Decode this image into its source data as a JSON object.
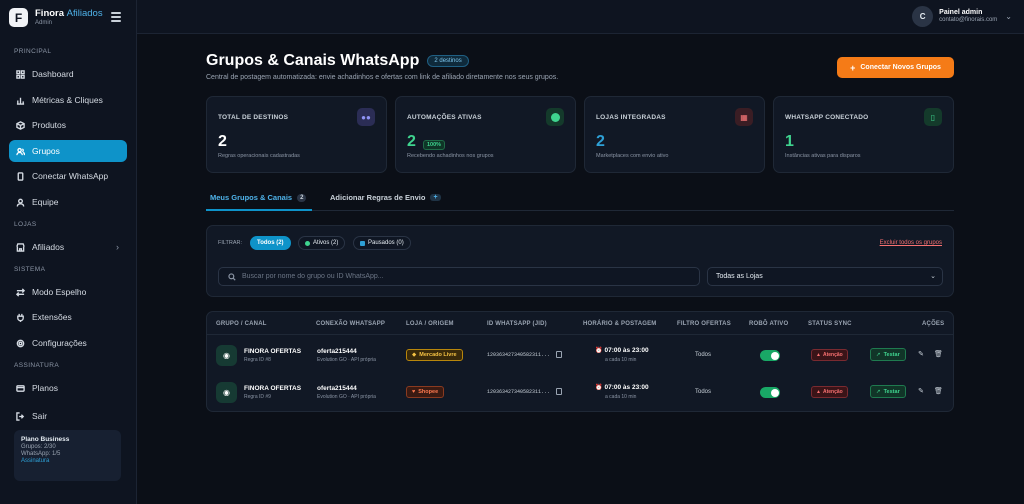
{
  "brand": {
    "logo_letter": "F",
    "name": "Finora",
    "name_accent": "Afiliados",
    "role": "Admin"
  },
  "sidebar": {
    "sections": {
      "principal": "PRINCIPAL",
      "lojas": "LOJAS",
      "sistema": "SISTEMA",
      "assinatura": "ASSINATURA"
    },
    "items": [
      {
        "label": "Dashboard",
        "icon": "grid-icon"
      },
      {
        "label": "Métricas & Cliques",
        "icon": "bar-chart-icon"
      },
      {
        "label": "Produtos",
        "icon": "box-icon"
      },
      {
        "label": "Grupos",
        "icon": "users-icon",
        "active": true
      },
      {
        "label": "Conectar WhatsApp",
        "icon": "phone-icon"
      },
      {
        "label": "Equipe",
        "icon": "user-icon"
      },
      {
        "label": "Afiliados",
        "icon": "store-icon"
      },
      {
        "label": "Modo Espelho",
        "icon": "swap-icon"
      },
      {
        "label": "Extensões",
        "icon": "plug-icon"
      },
      {
        "label": "Configurações",
        "icon": "gear-icon"
      },
      {
        "label": "Planos",
        "icon": "card-icon"
      },
      {
        "label": "Sair",
        "icon": "logout-icon"
      }
    ],
    "plan": {
      "title": "Plano Business",
      "groups": "Grupos: 2/30",
      "whatsapp": "WhatsApp: 1/5",
      "link": "Assinatura"
    }
  },
  "user": {
    "initial": "C",
    "name": "Painel admin",
    "email": "contato@finorais.com"
  },
  "header": {
    "title": "Grupos & Canais WhatsApp",
    "badge": "2 destinos",
    "subtitle": "Central de postagem automatizada: envie achadinhos e ofertas com link de afiliado diretamente nos seus grupos.",
    "cta": "Conectar Novos Grupos",
    "cta_icon": "+"
  },
  "stats": [
    {
      "label": "TOTAL DE DESTINOS",
      "value": "2",
      "caption": "Regras operacionais cadastradas",
      "icon": "users-icon",
      "color": "#ffffff"
    },
    {
      "label": "AUTOMAÇÕES ATIVAS",
      "value": "2",
      "badge": "100%",
      "caption": "Recebendo achadinhos nos grupos",
      "icon": "status-dot-icon",
      "color": "#3fd48f"
    },
    {
      "label": "LOJAS INTEGRADAS",
      "value": "2",
      "caption": "Marketplaces com envio ativo",
      "icon": "store-icon",
      "color": "#2ea0d6"
    },
    {
      "label": "WHATSAPP CONECTADO",
      "value": "1",
      "caption": "Instâncias ativas para disparos",
      "icon": "phone-icon",
      "color": "#3fd48f"
    }
  ],
  "tabs": [
    {
      "label": "Meus Grupos & Canais",
      "count": "2"
    },
    {
      "label": "Adicionar Regras de Envio",
      "extra": "+"
    }
  ],
  "filters": {
    "label": "FILTRAR:",
    "chips": [
      "Todos (2)",
      "Ativos (2)",
      "Pausados (0)"
    ],
    "delete_all": "Excluir todos os grupos",
    "search_placeholder": "Buscar por nome do grupo ou ID WhatsApp...",
    "store_select": "Todas as Lojas"
  },
  "table": {
    "headers": [
      "GRUPO / CANAL",
      "CONEXÃO WHATSAPP",
      "LOJA / ORIGEM",
      "ID WHATSAPP (JID)",
      "HORÁRIO & POSTAGEM",
      "FILTRO OFERTAS",
      "ROBÔ ATIVO",
      "STATUS SYNC",
      "AÇÕES"
    ],
    "rows": [
      {
        "name": "FINORA OFERTAS",
        "rule": "Regra ID #8",
        "conn": "oferta215444",
        "conn_sub": "Evolution GO · API própria",
        "store": "Mercado Livre",
        "jid": "120363427340582311...",
        "time": "07:00 às 23:00",
        "interval": "a cada 10 min",
        "filter": "Todos",
        "robot": true,
        "sync": "Atenção",
        "test": "Testar"
      },
      {
        "name": "FINORA OFERTAS",
        "rule": "Regra ID #9",
        "conn": "oferta215444",
        "conn_sub": "Evolution GO · API própria",
        "store": "Shopee",
        "jid": "120363427340582311...",
        "time": "07:00 às 23:00",
        "interval": "a cada 10 min",
        "filter": "Todos",
        "robot": true,
        "sync": "Atenção",
        "test": "Testar"
      }
    ]
  }
}
